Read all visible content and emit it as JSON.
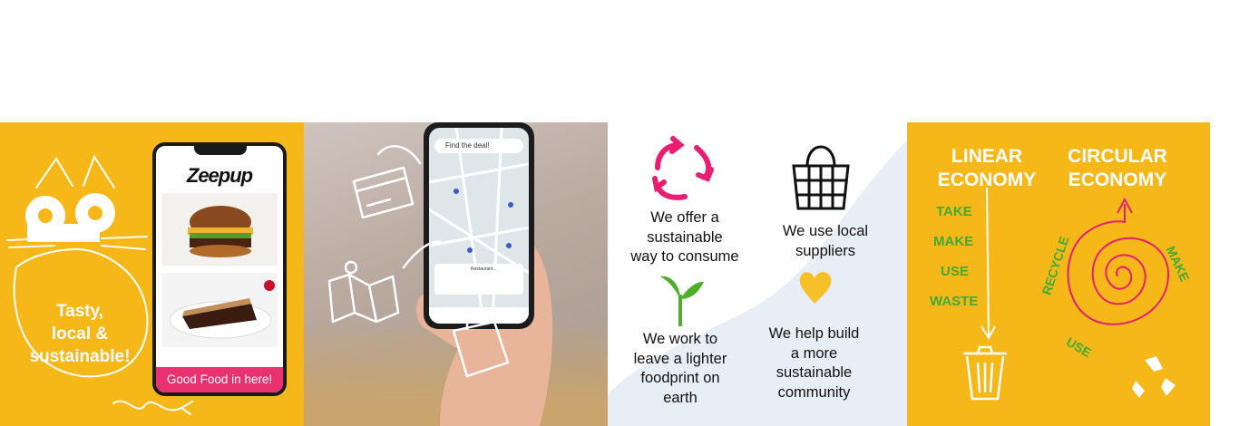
{
  "panel1": {
    "logo": "Zeepup",
    "tagline_line1": "Tasty,",
    "tagline_line2": "local &",
    "tagline_line3": "sustainable!",
    "cta": "Good Food in here!"
  },
  "panel2": {
    "search_placeholder": "Find the deal!",
    "card_title": "Restaurant..."
  },
  "panel3": {
    "item1": [
      "We offer a",
      "sustainable",
      "way to consume"
    ],
    "item2": [
      "We use local",
      "suppliers"
    ],
    "item3": [
      "We work to",
      "leave a lighter",
      "foodprint on",
      "earth"
    ],
    "item4": [
      "We help build",
      "a more",
      "sustainable",
      "community"
    ]
  },
  "panel4": {
    "linear_title": [
      "LINEAR",
      "ECONOMY"
    ],
    "circular_title": [
      "CIRCULAR",
      "ECONOMY"
    ],
    "linear_steps": [
      "TAKE",
      "MAKE",
      "USE",
      "WASTE"
    ],
    "circular_labels": {
      "recycle": "RECYCLE",
      "make": "MAKE",
      "use": "USE"
    }
  },
  "colors": {
    "yellow": "#f6b818",
    "pink": "#e9316f",
    "green": "#3faa35"
  }
}
